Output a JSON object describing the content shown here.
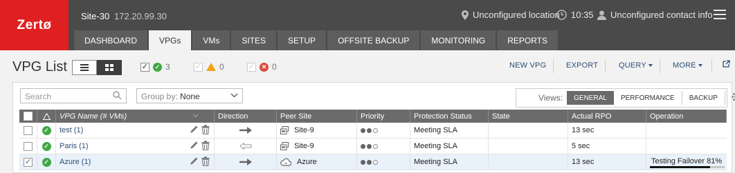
{
  "app": {
    "logo": "Zertø",
    "site_name": "Site-30",
    "site_ip": "172.20.99.30",
    "location": "Unconfigured location",
    "time": "10:35",
    "contact": "Unconfigured contact info"
  },
  "tabs": [
    "DASHBOARD",
    "VPGs",
    "VMs",
    "SITES",
    "SETUP",
    "OFFSITE BACKUP",
    "MONITORING",
    "REPORTS"
  ],
  "active_tab": "VPGs",
  "page": {
    "title": "VPG List",
    "filters": {
      "ok_count": "3",
      "warning_count": "0",
      "error_count": "0"
    },
    "actions": {
      "new_vpg": "NEW VPG",
      "export": "EXPORT",
      "query": "QUERY",
      "more": "MORE"
    }
  },
  "toolbar": {
    "search_placeholder": "Search",
    "group_by_label": "Group by:",
    "group_by_value": "None",
    "views_label": "Views:",
    "views": [
      "GENERAL",
      "PERFORMANCE",
      "BACKUP"
    ],
    "active_view": "GENERAL"
  },
  "table": {
    "columns": [
      "VPG Name (# VMs)",
      "Direction",
      "Peer Site",
      "Priority",
      "Protection Status",
      "State",
      "Actual RPO",
      "Operation"
    ],
    "rows": [
      {
        "name": "test (1)",
        "direction": "outgoing",
        "peer_site": "Site-9",
        "peer_type": "site",
        "priority": 2,
        "protection_status": "Meeting SLA",
        "state": "",
        "rpo": "13 sec",
        "operation": "",
        "checked": false
      },
      {
        "name": "Paris (1)",
        "direction": "incoming",
        "peer_site": "Site-9",
        "peer_type": "site",
        "priority": 2,
        "protection_status": "Meeting SLA",
        "state": "",
        "rpo": "5 sec",
        "operation": "",
        "checked": false
      },
      {
        "name": "Azure (1)",
        "direction": "outgoing",
        "peer_site": "Azure",
        "peer_type": "cloud",
        "priority": 2,
        "protection_status": "Meeting SLA",
        "state": "",
        "rpo": "13 sec",
        "operation": "Testing Failover 81%",
        "operation_progress": 0.81,
        "checked": true
      }
    ]
  },
  "colors": {
    "brand_red": "#e02020",
    "topbar": "#4a4a4a",
    "status_green": "#3ea843",
    "warning_amber": "#f2a416",
    "error_red": "#d94a3f",
    "link_blue": "#2b4d7a"
  },
  "icons": {
    "location": "map-pin-icon",
    "time": "clock-icon",
    "contact": "user-icon",
    "menu": "hamburger-icon",
    "search": "search-icon",
    "settings": "gear-icon",
    "edit": "pencil-icon",
    "delete": "trash-icon",
    "external": "external-link-icon"
  }
}
